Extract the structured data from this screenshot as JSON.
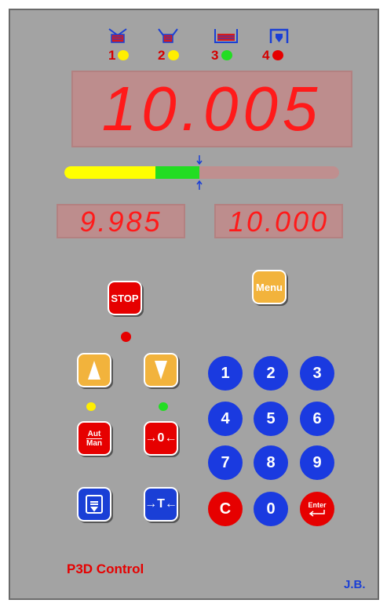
{
  "stages": {
    "items": [
      {
        "number": "1",
        "icon": "basket-fill-icon",
        "dot_color": "#ffee00"
      },
      {
        "number": "2",
        "icon": "basket-open-icon",
        "dot_color": "#ffee00"
      },
      {
        "number": "3",
        "icon": "bin-full-icon",
        "dot_color": "#22dd22"
      },
      {
        "number": "4",
        "icon": "discharge-icon",
        "dot_color": "#e60000"
      }
    ]
  },
  "displays": {
    "main_weight": "10.005",
    "left_value": "9.985",
    "right_value": "10.000"
  },
  "progress": {
    "yellow_fraction": 0.33,
    "green_fraction": 0.16
  },
  "buttons": {
    "stop_label": "STOP",
    "menu_label": "Menu",
    "aut_label": "Aut",
    "man_label": "Man",
    "zero_label": "→0←",
    "tare_label": "→T←",
    "enter_label": "Enter",
    "clear_label": "C"
  },
  "keypad": [
    "1",
    "2",
    "3",
    "4",
    "5",
    "6",
    "7",
    "8",
    "9",
    "0"
  ],
  "indicators": {
    "stop_led": "#e60000",
    "up_led": "#ffee00",
    "down_led": "#22dd22"
  },
  "footer": {
    "brand": "P3D Control",
    "initials": "J.B."
  },
  "colors": {
    "panel": "#a3a3a3",
    "display_bg": "#bd8d8d",
    "segment": "#ff1a1a",
    "red": "#e60000",
    "yellow": "#f2b33c",
    "blue": "#1a3fd6"
  }
}
